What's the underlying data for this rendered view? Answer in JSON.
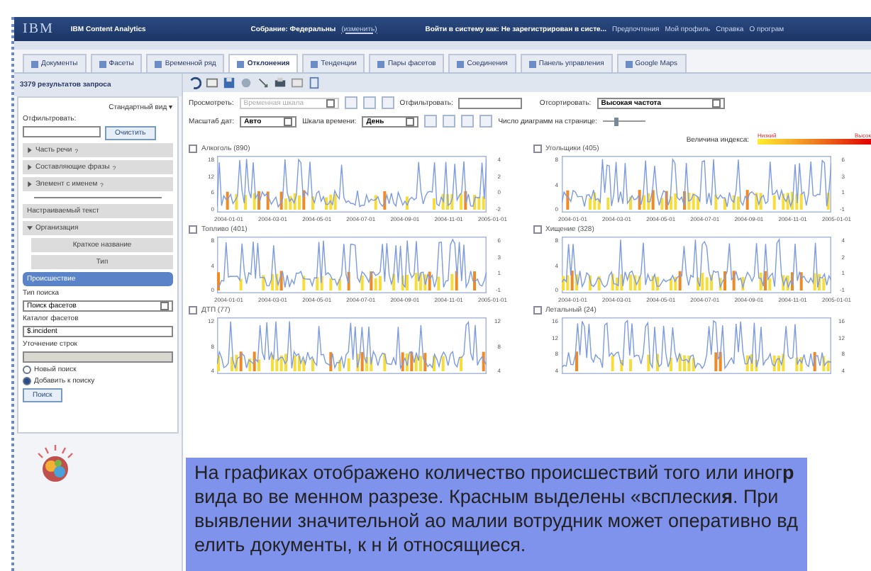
{
  "header": {
    "logo": "IBM",
    "product": "IBM Content Analytics",
    "collection_label": "Собрание: Федеральны",
    "collection_link": "(изменить)",
    "user_text": "Войти в систему как: Не зарегистрирован в систе...",
    "links": [
      "Предпочтения",
      "Мой профиль",
      "Справка",
      "О програм"
    ]
  },
  "tabs": [
    {
      "label": "Документы",
      "selected": false
    },
    {
      "label": "Фасеты",
      "selected": false
    },
    {
      "label": "Временной ряд",
      "selected": false
    },
    {
      "label": "Отклонения",
      "selected": true
    },
    {
      "label": "Тенденции",
      "selected": false
    },
    {
      "label": "Пары фасетов",
      "selected": false
    },
    {
      "label": "Соединения",
      "selected": false
    },
    {
      "label": "Панель управления",
      "selected": false
    },
    {
      "label": "Google Maps",
      "selected": false
    }
  ],
  "results_title": "3379 результатов запроса",
  "sidebar": {
    "view_menu": "Стандартный вид ▾",
    "filter_label": "Отфильтровать:",
    "clear_button": "Очистить",
    "facets": [
      {
        "label": "Часть речи",
        "help": "?",
        "expanded": false,
        "selected": false
      },
      {
        "label": "Составляющие фразы",
        "help": "?",
        "expanded": false,
        "selected": false
      },
      {
        "label": "Элемент с именем",
        "help": "?",
        "expanded": false,
        "selected": false
      },
      {
        "label": "Настраиваемый текст",
        "selected": false
      },
      {
        "label": "Организация",
        "expanded": true,
        "selected": false,
        "children": [
          {
            "label": "Краткое название",
            "selected": false
          },
          {
            "label": "Тип",
            "selected": false
          }
        ]
      },
      {
        "label": "Происшествие",
        "selected": true
      }
    ],
    "search_type_label": "Тип поиска",
    "search_type_value": "Поиск фасетов",
    "catalog_label": "Каталог фасетов",
    "catalog_value": "$.incident",
    "refine_label": "Уточнение строк",
    "refine_disabled": true,
    "modes": [
      {
        "label": "Новый поиск",
        "selected": false
      },
      {
        "label": "Добавить к поиску",
        "selected": true
      }
    ],
    "search_button": "Поиск"
  },
  "toolbar": {
    "view_label": "Просмотреть:",
    "view_value": "Временная шкала",
    "view_disabled": true,
    "filter_label": "Отфильтровать:",
    "sort_label": "Отсортировать:",
    "sort_value": "Высокая частота",
    "date_scale_label": "Масштаб дат:",
    "date_scale_value": "Авто",
    "time_scale_label": "Шкала времени:",
    "time_scale_value": "День",
    "per_page_label": "Число диаграмм на странице:",
    "per_page_slider": {
      "level": 0.3
    }
  },
  "legend": {
    "label": "Величина индекса:",
    "low": "Низкий",
    "high": "Высок"
  },
  "charts": [
    {
      "title": "Алкоголь (890)",
      "checked": false,
      "yticks": [
        "18",
        "12",
        "6",
        "0"
      ],
      "right_ticks": [
        "4",
        "2",
        "0",
        "-2"
      ],
      "xticks": [
        "2004-01-01",
        "2004-03-01",
        "2004-05-01",
        "2004-07-01",
        "2004-09-01",
        "2004-11-01",
        "2005-01-01"
      ]
    },
    {
      "title": "Угольщики (405)",
      "checked": false,
      "yticks": [
        "8",
        "4",
        "0"
      ],
      "right_ticks": [
        "6",
        "3",
        "1",
        "-1"
      ],
      "xticks": [
        "2004-01-01",
        "2004-03-01",
        "2004-05-01",
        "2004-07-01",
        "2004-09-01",
        "2004-11-01",
        "2005-01-01"
      ]
    },
    {
      "title": "Топливо (401)",
      "checked": false,
      "yticks": [
        "8",
        "4",
        "0"
      ],
      "right_ticks": [
        "6",
        "3",
        "1",
        "-1"
      ],
      "xticks": [
        "2004-01-01",
        "2004-03-01",
        "2004-05-01",
        "2004-07-01",
        "2004-09-01",
        "2004-11-01",
        "2005-01-01"
      ]
    },
    {
      "title": "Хищение (328)",
      "checked": false,
      "yticks": [
        "8",
        "4",
        "0"
      ],
      "right_ticks": [
        "4",
        "2",
        "1",
        "-1"
      ],
      "xticks": [
        "2004-01-01",
        "2004-03-01",
        "2004-05-01",
        "2004-07-01",
        "2004-09-01",
        "2004-11-01",
        "2005-01-01"
      ]
    },
    {
      "title": "ДТП (77)",
      "checked": false,
      "yticks": [
        "12",
        "8",
        "4"
      ],
      "right_ticks": [
        "12",
        "8",
        "4"
      ]
    },
    {
      "title": "Летальный (24)",
      "checked": false,
      "yticks": [
        "16",
        "12",
        "8",
        "4"
      ],
      "right_ticks": [
        "16",
        "12",
        "8",
        "4"
      ]
    }
  ],
  "caption": "На графиках отображено количество происшествий того или иног**р** вида во ве  менном разрезе. Красным выделены «всплески**я**. При выявлении значительной ао  малии вотрудник может оперативно вд  елить документы, к н  й относящиеся."
}
